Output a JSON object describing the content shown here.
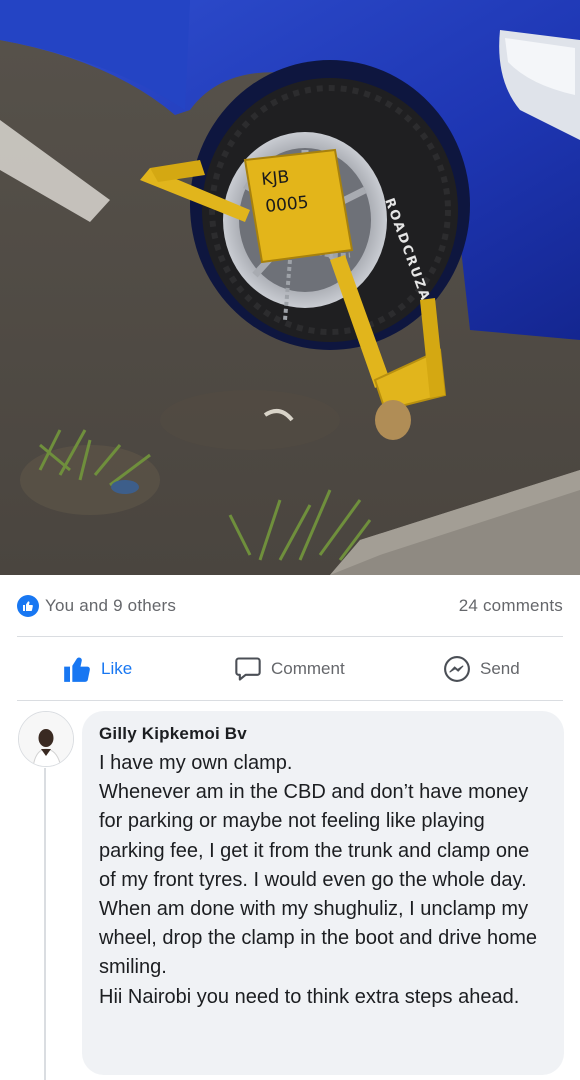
{
  "photo": {
    "description_icon": "car-wheel-clamp-photo",
    "plate_line1": "KJB",
    "plate_line2": "0005",
    "tyre_text": "ROADCRUZA"
  },
  "reactions": {
    "icon": "like-badge-icon",
    "text": "You and 9 others",
    "comments_count": "24 comments"
  },
  "actions": {
    "like_label": "Like",
    "comment_label": "Comment",
    "send_label": "Send"
  },
  "comment": {
    "author": "Gilly Kipkemoi Bv",
    "text": "I have my own clamp.\nWhenever am in the CBD and don’t have money for parking or maybe not feeling like playing parking fee, I get it from the trunk and clamp one of my front tyres. I would even go the whole day.\nWhen am done with my shughuliz, I unclamp my wheel, drop the clamp in the boot and drive home smiling.\nHii Nairobi you need to think extra steps ahead."
  },
  "colors": {
    "accent": "#1877f2",
    "muted_text": "#65676b",
    "bubble_bg": "#f0f2f5"
  }
}
